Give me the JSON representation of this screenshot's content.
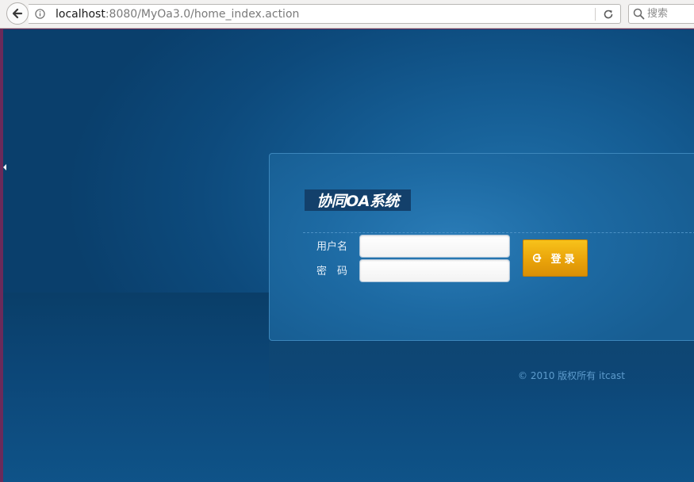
{
  "browser": {
    "url_host": "localhost",
    "url_rest": ":8080/MyOa3.0/home_index.action",
    "search_placeholder": "搜索",
    "icons": {
      "back": "back-arrow-icon",
      "info": "info-icon",
      "reload": "reload-icon",
      "search": "search-icon"
    }
  },
  "login": {
    "logo_text": "协同OA系统",
    "username_label": "用户名",
    "password_label": "密　码",
    "username_value": "",
    "password_value": "",
    "button_label": "登录",
    "button_icon": "arrow-circle-right-icon"
  },
  "footer": {
    "copyright": "© 2010 版权所有 itcast"
  },
  "colors": {
    "page_background": "#155d94",
    "button_accent": "#eaa40a",
    "copyright_text": "#5d9bcc"
  }
}
